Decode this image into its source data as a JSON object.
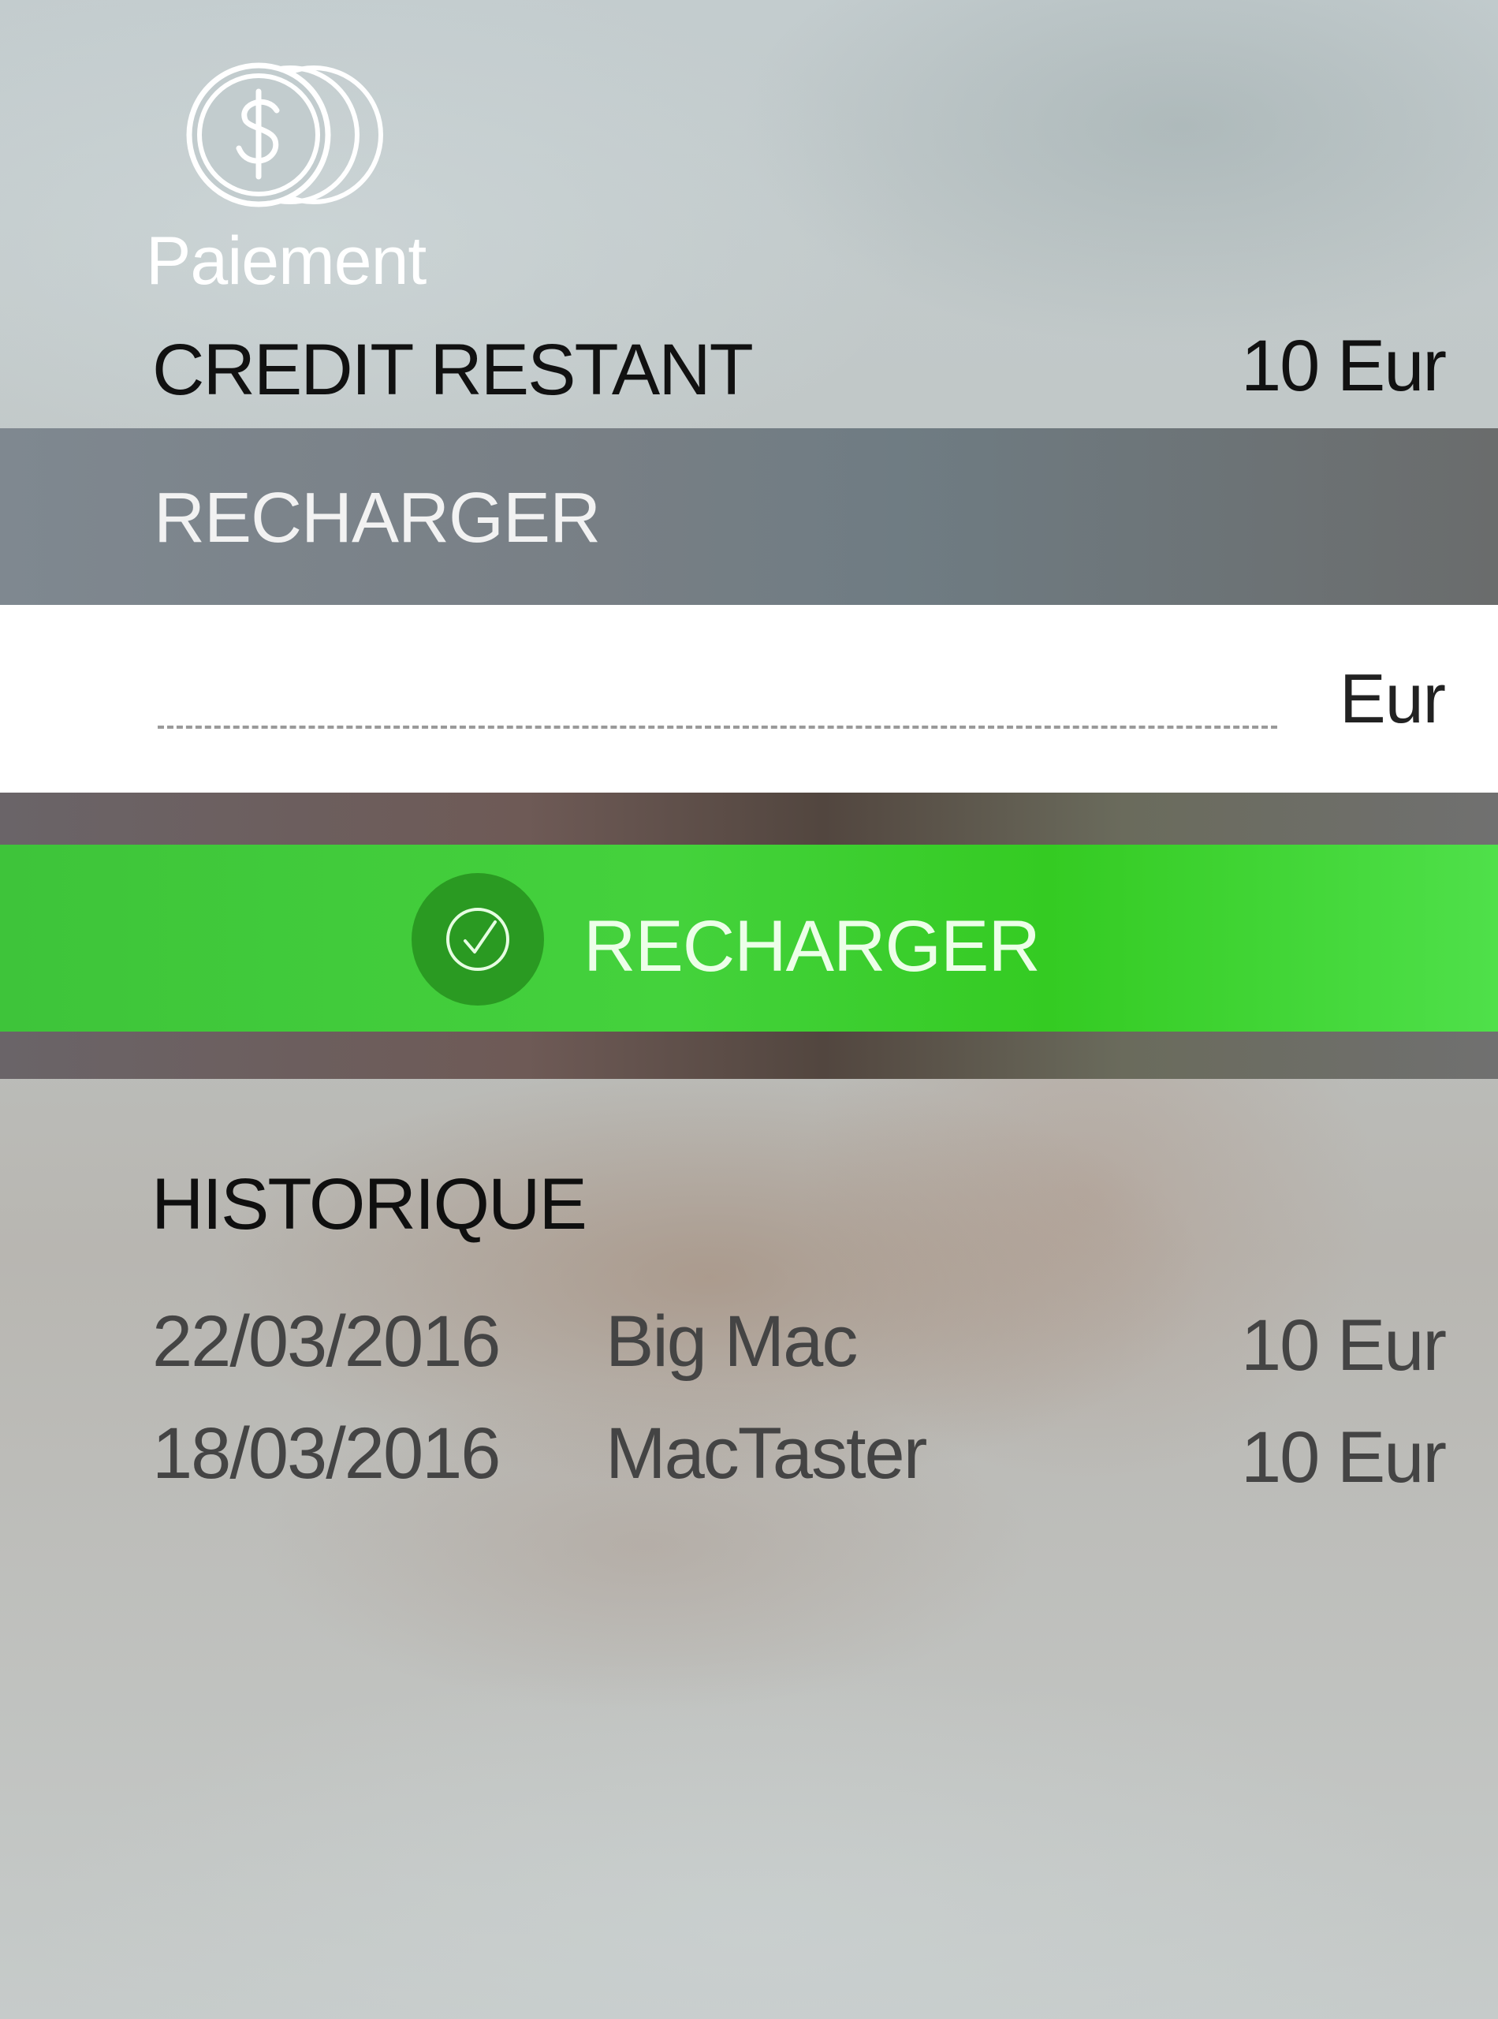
{
  "header": {
    "icon": "coins-dollar-icon",
    "title": "Paiement"
  },
  "credit": {
    "label": "CREDIT RESTANT",
    "value": "10 Eur"
  },
  "recharge_section": {
    "label": "RECHARGER"
  },
  "amount_input": {
    "value": "",
    "placeholder": "",
    "unit": "Eur"
  },
  "recharge_button": {
    "icon": "check-circle-icon",
    "label": "RECHARGER",
    "color": "#44d23c"
  },
  "history": {
    "title": "HISTORIQUE",
    "rows": [
      {
        "date": "22/03/2016",
        "item": "Big Mac",
        "amount": "10 Eur"
      },
      {
        "date": "18/03/2016",
        "item": "MacTaster",
        "amount": "10 Eur"
      }
    ]
  }
}
